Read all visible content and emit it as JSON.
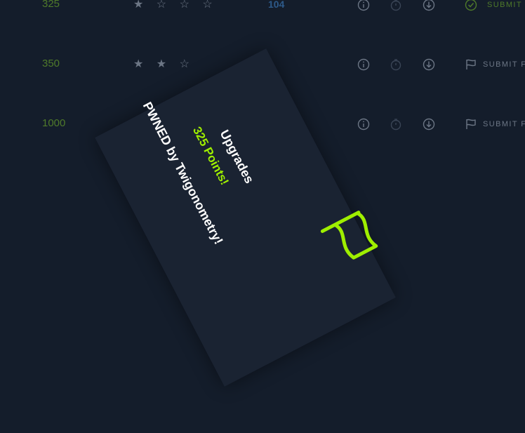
{
  "challenges": [
    {
      "points": "325",
      "stars": "★ ☆ ☆ ☆",
      "solves": "104",
      "submit_label": "SUBMIT",
      "solved": true
    },
    {
      "points": "350",
      "stars": "★ ★ ☆",
      "solves": "",
      "submit_label": "SUBMIT F",
      "solved": false
    },
    {
      "points": "1000",
      "stars": "",
      "solves": "",
      "submit_label": "SUBMIT F",
      "solved": false
    }
  ],
  "toast": {
    "title": "Upgrades",
    "points_text": "325 Points!",
    "owner_text": "PWNED by Twigonometry!",
    "icon": "flag-icon"
  },
  "colors": {
    "background": "#141d2b",
    "card": "#1a2332",
    "accent": "#9fef00",
    "points": "#4f7a2a",
    "solves": "#2d5a8a",
    "muted": "#6c7685"
  }
}
